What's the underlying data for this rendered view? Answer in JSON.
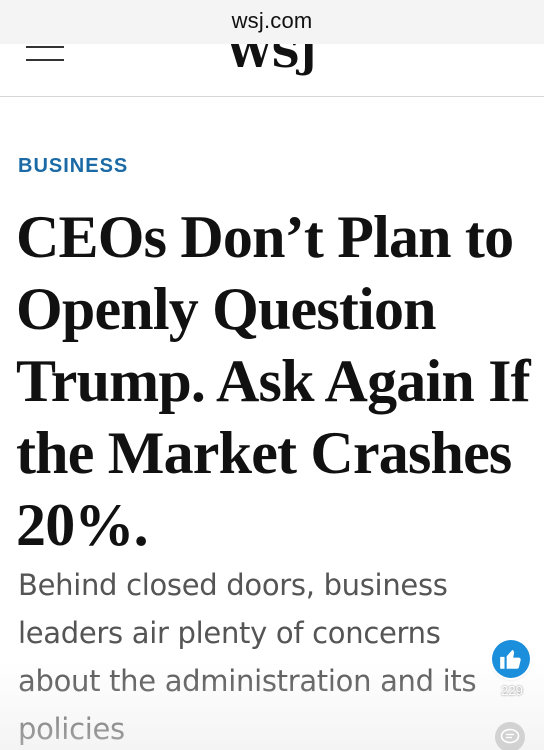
{
  "browser": {
    "url": "wsj.com"
  },
  "header": {
    "logo": "WSJ",
    "menu_icon": "hamburger-menu-icon"
  },
  "article": {
    "section": "BUSINESS",
    "headline": "CEOs Don’t Plan to Openly Question Trump. Ask Again If the Market Crashes 20%.",
    "dek": "Behind closed doors, business leaders air plenty of concerns about the administration and its policies"
  },
  "overlay": {
    "like_icon": "thumbs-up-icon",
    "like_count": "229",
    "comment_icon": "comment-bubble-icon"
  },
  "colors": {
    "section_accent": "#1b6aa5",
    "like_button": "#1c8fdc",
    "headline_text": "#111111",
    "dek_text": "#555555"
  }
}
